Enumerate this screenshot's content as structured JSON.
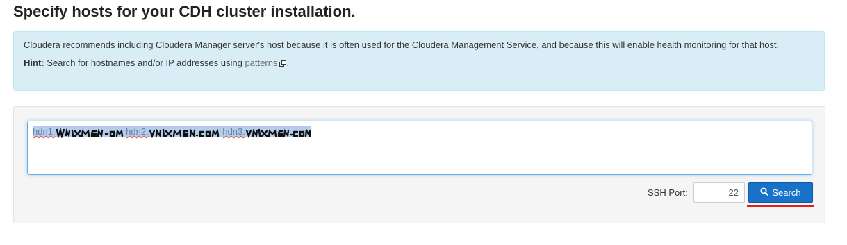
{
  "page": {
    "title": "Specify hosts for your CDH cluster installation."
  },
  "info": {
    "message": "Cloudera recommends including Cloudera Manager server's host because it is often used for the Cloudera Management Service, and because this will enable health monitoring for that host.",
    "hint_label": "Hint:",
    "hint_text": "Search for hostnames and/or IP addresses using",
    "patterns_link": "patterns",
    "hint_end": "."
  },
  "search": {
    "hosts": [
      {
        "prefix": "hdn1.",
        "redacted_text": "unixmen.com"
      },
      {
        "prefix": "hdn2.",
        "redacted_text": "unixmen.com"
      },
      {
        "prefix": "hdn3.",
        "redacted_text": "unixmen.com"
      }
    ],
    "ssh_port_label": "SSH Port:",
    "ssh_port_value": "22",
    "search_button_label": "Search"
  },
  "colors": {
    "info_bg": "#d9edf7",
    "selection_bg": "#b4cdec",
    "search_button_bg": "#1873c8",
    "annotation_underline": "#e0221d"
  },
  "icons": {
    "external_link": "external-link-icon",
    "search": "search-icon"
  }
}
